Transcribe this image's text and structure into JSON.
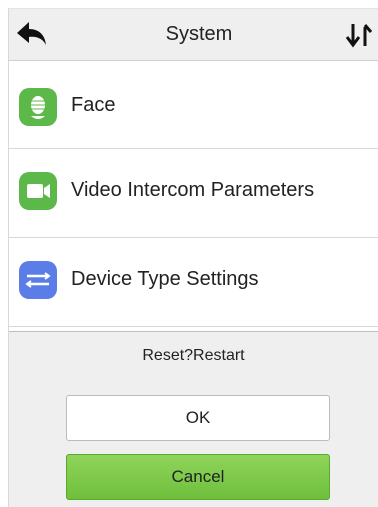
{
  "header": {
    "title": "System",
    "back_icon": "back-arrow-icon",
    "sort_icon": "sort-arrows-icon"
  },
  "menu": {
    "items": [
      {
        "label": "Face",
        "icon": "face-icon",
        "icon_color": "#5cb848"
      },
      {
        "label": "Video Intercom Parameters",
        "icon": "video-camera-icon",
        "icon_color": "#5cb848"
      },
      {
        "label": "Device Type Settings",
        "icon": "device-type-icon",
        "icon_color": "#5b7de8"
      }
    ]
  },
  "dialog": {
    "title": "Reset?Restart",
    "ok_label": "OK",
    "cancel_label": "Cancel"
  },
  "colors": {
    "header_bg": "#efefef",
    "dialog_bg": "#efefef",
    "cancel_bg": "#7cc84a"
  }
}
